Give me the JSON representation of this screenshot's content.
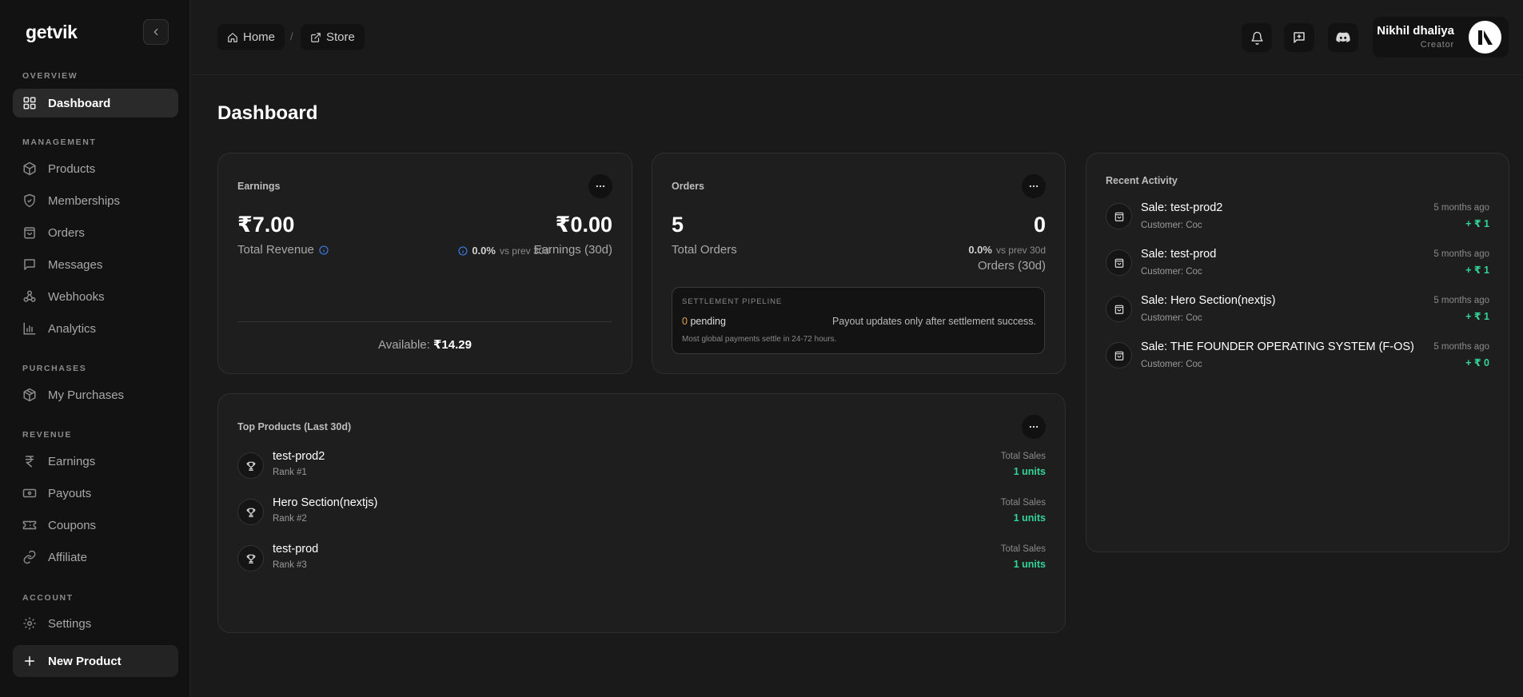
{
  "app": {
    "logo": "getvik"
  },
  "sidebar": {
    "sections": {
      "overview": "OVERVIEW",
      "management": "MANAGEMENT",
      "purchases": "PURCHASES",
      "revenue": "REVENUE",
      "account": "ACCOUNT"
    },
    "items": {
      "dashboard": "Dashboard",
      "products": "Products",
      "memberships": "Memberships",
      "orders": "Orders",
      "messages": "Messages",
      "webhooks": "Webhooks",
      "analytics": "Analytics",
      "my_purchases": "My Purchases",
      "earnings": "Earnings",
      "payouts": "Payouts",
      "coupons": "Coupons",
      "affiliate": "Affiliate",
      "settings": "Settings"
    },
    "active": "dashboard",
    "new_product": "New Product"
  },
  "header": {
    "breadcrumb": {
      "home": "Home",
      "separator": "/",
      "store": "Store"
    },
    "user": {
      "name": "Nikhil dhaliya",
      "role": "Creator"
    }
  },
  "page": {
    "title": "Dashboard"
  },
  "earnings_card": {
    "title": "Earnings",
    "total_revenue_value": "₹7.00",
    "total_revenue_label": "Total Revenue",
    "earnings_30d_value": "₹0.00",
    "earnings_30d_label": "Earnings (30d)",
    "change_pct": "0.0%",
    "change_label": "vs prev 30d",
    "available_label": "Available:",
    "available_value": "₹14.29"
  },
  "orders_card": {
    "title": "Orders",
    "total_value": "5",
    "total_label": "Total Orders",
    "orders_30d_value": "0",
    "orders_30d_label": "Orders (30d)",
    "change_pct": "0.0%",
    "change_label": "vs prev 30d",
    "pipeline": {
      "label": "SETTLEMENT PIPELINE",
      "pending_count": "0",
      "pending_label": "pending",
      "message": "Payout updates only after settlement success.",
      "note": "Most global payments settle in 24-72 hours."
    }
  },
  "top_products": {
    "title": "Top Products (Last 30d)",
    "total_sales_label": "Total Sales",
    "items": [
      {
        "name": "test-prod2",
        "rank": "Rank #1",
        "units": "1 units"
      },
      {
        "name": "Hero Section(nextjs)",
        "rank": "Rank #2",
        "units": "1 units"
      },
      {
        "name": "test-prod",
        "rank": "Rank #3",
        "units": "1 units"
      }
    ]
  },
  "recent_activity": {
    "title": "Recent Activity",
    "items": [
      {
        "title": "Sale: test-prod2",
        "customer": "Customer: Coc",
        "time": "5 months ago",
        "amount": "+ ₹ 1"
      },
      {
        "title": "Sale: test-prod",
        "customer": "Customer: Coc",
        "time": "5 months ago",
        "amount": "+ ₹ 1"
      },
      {
        "title": "Sale: Hero Section(nextjs)",
        "customer": "Customer: Coc",
        "time": "5 months ago",
        "amount": "+ ₹ 1"
      },
      {
        "title": "Sale: THE FOUNDER OPERATING SYSTEM (F-OS)",
        "customer": "Customer: Coc",
        "time": "5 months ago",
        "amount": "+ ₹ 0"
      }
    ]
  },
  "colors": {
    "background": "#1a1a1a",
    "sidebar": "#121212",
    "card": "#1e1e1e",
    "positive": "#34d399",
    "pending": "#e0a050",
    "info": "#3b82f6"
  }
}
